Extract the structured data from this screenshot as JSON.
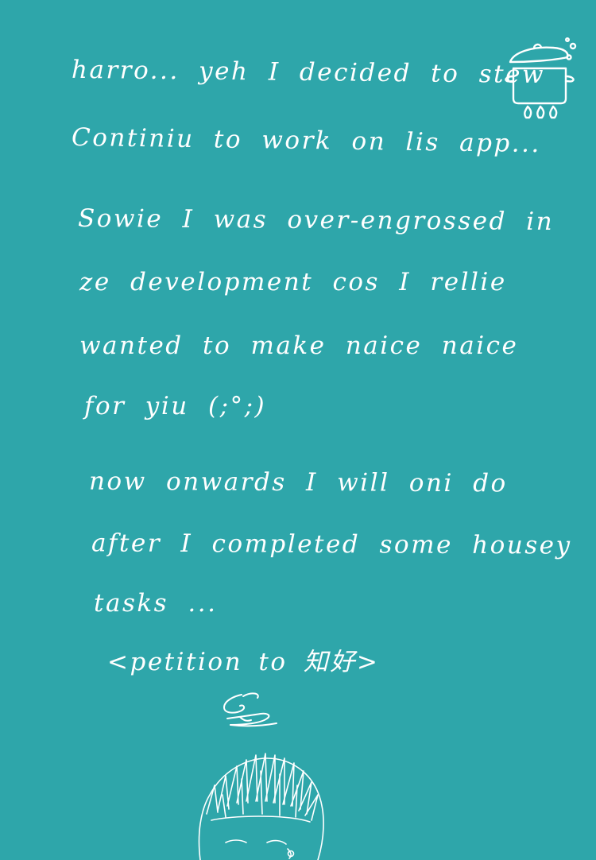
{
  "background_color": "#2ea6aa",
  "ink_color": "#ffffff",
  "note": {
    "lines": [
      "harro... yeh I decided to stew",
      "Continiu to work on lis app...",
      "Sowie I was over-engrossed in",
      "ze development cos I rellie",
      "wanted to make naice naice",
      "for yiu (;°;)",
      "now onwards I will oni do",
      "after I completed some housey",
      "tasks ...",
      "<petition to 知好>"
    ]
  },
  "illustrations": {
    "pot": "stew-pot-icon",
    "signature": "signature-scribble",
    "portrait": "spiky-hair-face-sketch"
  }
}
